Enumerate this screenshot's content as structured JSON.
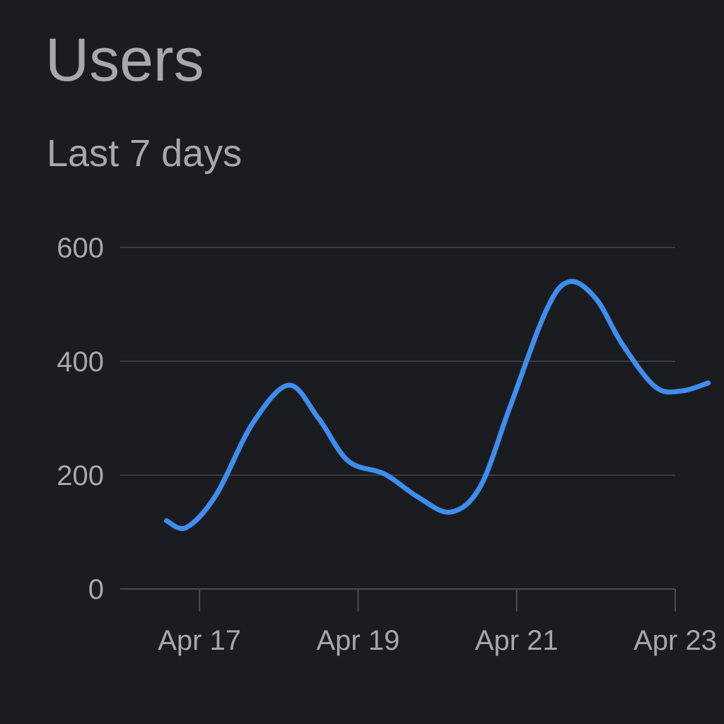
{
  "header": {
    "title": "Users",
    "subtitle": "Last 7 days"
  },
  "colors": {
    "background": "#1b1c20",
    "text": "#a7a8ac",
    "grid": "#3a3c42",
    "series": "#3d8ef0"
  },
  "chart_data": {
    "type": "line",
    "title": "Users",
    "subtitle": "Last 7 days",
    "xlabel": "",
    "ylabel": "",
    "ylim": [
      0,
      600
    ],
    "xlim": [
      "Apr 16",
      "Apr 23"
    ],
    "y_ticks": [
      0,
      200,
      400,
      600
    ],
    "x_ticks": [
      "Apr 17",
      "Apr 19",
      "Apr 21",
      "Apr 23"
    ],
    "grid": true,
    "legend": "none",
    "series": [
      {
        "color": "#3d8ef0",
        "points": [
          {
            "x": "Apr 16 14:00",
            "y": 120
          },
          {
            "x": "Apr 16 20:00",
            "y": 108
          },
          {
            "x": "Apr 17 05:00",
            "y": 165
          },
          {
            "x": "Apr 17 16:00",
            "y": 290
          },
          {
            "x": "Apr 18 03:00",
            "y": 358
          },
          {
            "x": "Apr 18 12:00",
            "y": 300
          },
          {
            "x": "Apr 18 21:00",
            "y": 225
          },
          {
            "x": "Apr 19 08:00",
            "y": 202
          },
          {
            "x": "Apr 19 18:00",
            "y": 162
          },
          {
            "x": "Apr 20 04:00",
            "y": 135
          },
          {
            "x": "Apr 20 13:00",
            "y": 180
          },
          {
            "x": "Apr 20 22:00",
            "y": 320
          },
          {
            "x": "Apr 21 09:00",
            "y": 490
          },
          {
            "x": "Apr 21 16:00",
            "y": 540
          },
          {
            "x": "Apr 22 00:00",
            "y": 510
          },
          {
            "x": "Apr 22 08:00",
            "y": 430
          },
          {
            "x": "Apr 22 18:00",
            "y": 355
          },
          {
            "x": "Apr 23 02:00",
            "y": 348
          },
          {
            "x": "Apr 23 10:00",
            "y": 362
          }
        ]
      }
    ]
  }
}
